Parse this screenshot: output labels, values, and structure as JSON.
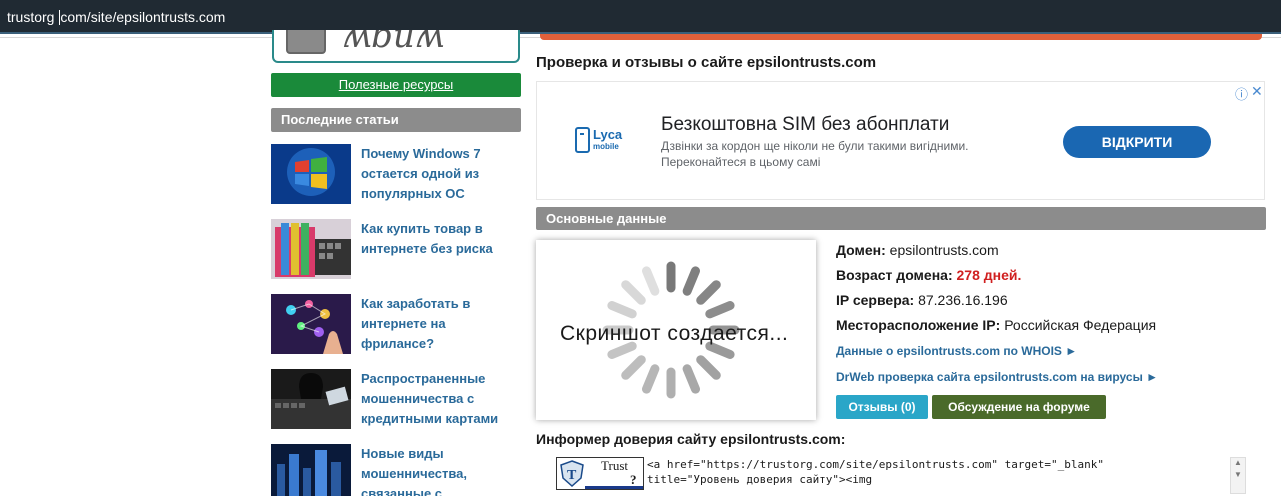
{
  "address_bar": {
    "url_before_caret": "trustorg ",
    "url_after_caret": "com/site/epsilontrusts.com"
  },
  "sidebar": {
    "resources_label": "Полезные ресурсы",
    "recent_header": "Последние статьи",
    "articles": [
      {
        "title": "Почему Windows 7 остается одной из популярных ОС",
        "thumb_icon": "windows-logo"
      },
      {
        "title": "Как купить товар в интернете без риска",
        "thumb_icon": "credit-cards-keyboard"
      },
      {
        "title": "Как заработать в интернете на фрилансе?",
        "thumb_icon": "network-hand"
      },
      {
        "title": "Распространенные мошенничества с кредитными картами",
        "thumb_icon": "hacker-keyboard"
      },
      {
        "title": "Новые виды мошенничества, связанные с",
        "thumb_icon": "digital-city"
      }
    ]
  },
  "main": {
    "heading": "Проверка и отзывы о сайте epsilontrusts.com",
    "ad": {
      "brand_top": "Lyca",
      "brand_bottom": "mobile",
      "title": "Безкоштовна SIM без абонплати",
      "desc_line1": "Дзвінки за кордон ще ніколи не були такими вигідними.",
      "desc_line2": "Переконайтеся в цьому самі",
      "cta": "ВІДКРИТИ",
      "info_icon": "ⓘ",
      "close_icon": "✕"
    },
    "basic_header": "Основные данные",
    "screenshot_text": "Скриншот создается...",
    "info": {
      "domain_label": "Домен:",
      "domain_value": "epsilontrusts.com",
      "age_label": "Возраст домена:",
      "age_value": "278 дней.",
      "ip_label": "IP сервера:",
      "ip_value": "87.236.16.196",
      "location_label": "Месторасположение IP:",
      "location_value": "Российская Федерация",
      "whois_link": "Данные о epsilontrusts.com по WHOIS ►",
      "drweb_link": "DrWeb проверка сайта epsilontrusts.com на вирусы ►",
      "reviews_btn": "Отзывы (0)",
      "forum_btn": "Обсуждение на форуме"
    },
    "informer": {
      "heading": "Информер доверия сайту epsilontrusts.com:",
      "badge_word": "Trust",
      "badge_q": "?",
      "code_line1": "<a href=\"https://trustorg.com/site/epsilontrusts.com\" target=\"_blank\"",
      "code_line2": "title=\"Уровень доверия сайту\"><img"
    }
  },
  "colors": {
    "address_bg": "#202a33",
    "green_button": "#1a8a3a",
    "grey_header": "#8c8c8c",
    "link_blue": "#2a6a9a",
    "ad_cta": "#1a67b2",
    "reviews_btn": "#2aa6c8",
    "forum_btn": "#4a6a2a",
    "age_red": "#d02020"
  }
}
